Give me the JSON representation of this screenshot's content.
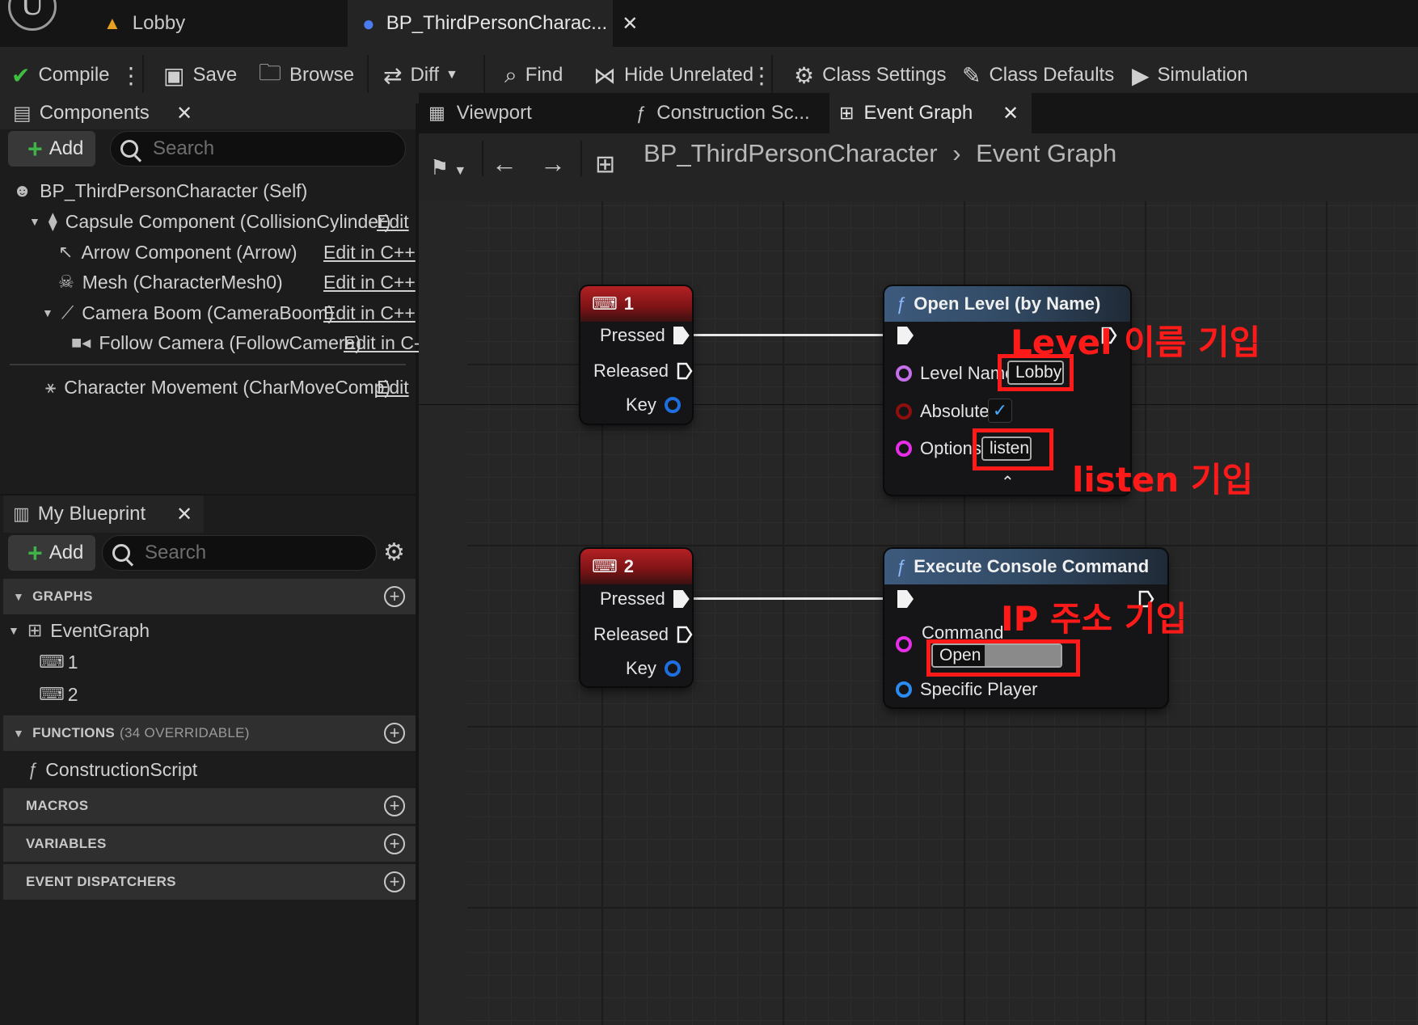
{
  "doc_tabs": [
    {
      "label": "Lobby",
      "icon": "level-icon"
    },
    {
      "label": "BP_ThirdPersonCharac...",
      "icon": "character-icon",
      "active": true
    }
  ],
  "toolbar": {
    "compile": "Compile",
    "save": "Save",
    "browse": "Browse",
    "diff": "Diff",
    "find": "Find",
    "hide_unrelated": "Hide Unrelated",
    "class_settings": "Class Settings",
    "class_defaults": "Class Defaults",
    "simulation": "Simulation"
  },
  "components_panel": {
    "title": "Components",
    "add": "Add",
    "search_placeholder": "Search",
    "items": [
      {
        "label": "BP_ThirdPersonCharacter (Self)",
        "edit": ""
      },
      {
        "label": "Capsule Component (CollisionCylinder)",
        "edit": "Edit"
      },
      {
        "label": "Arrow Component (Arrow)",
        "edit": "Edit in C++"
      },
      {
        "label": "Mesh (CharacterMesh0)",
        "edit": "Edit in C++"
      },
      {
        "label": "Camera Boom (CameraBoom)",
        "edit": "Edit in C++"
      },
      {
        "label": "Follow Camera (FollowCamera)",
        "edit": "Edit in C-"
      },
      {
        "label": "Character Movement (CharMoveComp)",
        "edit": "Edit"
      }
    ]
  },
  "my_blueprint": {
    "title": "My Blueprint",
    "add": "Add",
    "search_placeholder": "Search",
    "graphs_header": "GRAPHS",
    "graphs": [
      "EventGraph",
      "1",
      "2"
    ],
    "functions_header": "FUNCTIONS",
    "functions_sub": "(34 OVERRIDABLE)",
    "functions": [
      "ConstructionScript"
    ],
    "macros_header": "MACROS",
    "variables_header": "VARIABLES",
    "dispatchers_header": "EVENT DISPATCHERS"
  },
  "graph_tabs": [
    {
      "label": "Viewport"
    },
    {
      "label": "Construction Sc..."
    },
    {
      "label": "Event Graph",
      "active": true
    }
  ],
  "breadcrumb": {
    "blueprint": "BP_ThirdPersonCharacter",
    "graph": "Event Graph"
  },
  "nodes": {
    "key1": {
      "title": "1",
      "pressed": "Pressed",
      "released": "Released",
      "key": "Key"
    },
    "key2": {
      "title": "2",
      "pressed": "Pressed",
      "released": "Released",
      "key": "Key"
    },
    "open_level": {
      "title": "Open Level (by Name)",
      "level_name_label": "Level Name",
      "level_name_value": "Lobby",
      "absolute_label": "Absolute",
      "absolute_checked": true,
      "options_label": "Options",
      "options_value": "listen"
    },
    "exec_console": {
      "title": "Execute Console Command",
      "command_label": "Command",
      "command_value": "Open 1",
      "specific_player_label": "Specific Player"
    }
  },
  "annotations": {
    "level_name": "Level 이름 기입",
    "listen": "listen 기입",
    "ip": "IP 주소 기입"
  },
  "colors": {
    "accent_red": "#ff1a1a",
    "key_node_header": "#b32124",
    "function_node_header": "#3d5a7d",
    "name_pin": "#c470e8",
    "bool_pin": "#8f0e0e",
    "string_pin": "#e62ee6",
    "object_pin": "#2a8cf0"
  }
}
